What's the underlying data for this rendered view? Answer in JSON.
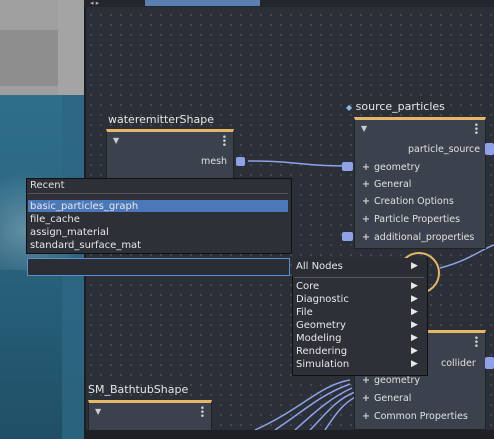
{
  "viewport": {
    "label": ""
  },
  "nodes": {
    "wateremitter": {
      "title": "wateremitterShape",
      "output": "mesh"
    },
    "source_particles": {
      "title": "source_particles",
      "output": "particle_source",
      "attributes": [
        "geometry",
        "General",
        "Creation Options",
        "Particle Properties",
        "additional_properties"
      ]
    },
    "collider_node": {
      "output": "collider",
      "attributes": [
        "geometry",
        "General",
        "Common Properties"
      ]
    },
    "bathtub": {
      "title": "SM_BathtubShape"
    }
  },
  "popup": {
    "recent_title": "Recent",
    "recent_items": [
      "basic_particles_graph",
      "file_cache",
      "assign_material",
      "standard_surface_mat"
    ],
    "search_value": "",
    "all_nodes_label": "All Nodes",
    "categories": [
      "Core",
      "Diagnostic",
      "File",
      "Geometry",
      "Modeling",
      "Rendering",
      "Simulation"
    ]
  },
  "ruler_text": "",
  "colors": {
    "accent": "#e6b765",
    "highlight": "#4a78b8",
    "port": "#8fa2e8"
  }
}
